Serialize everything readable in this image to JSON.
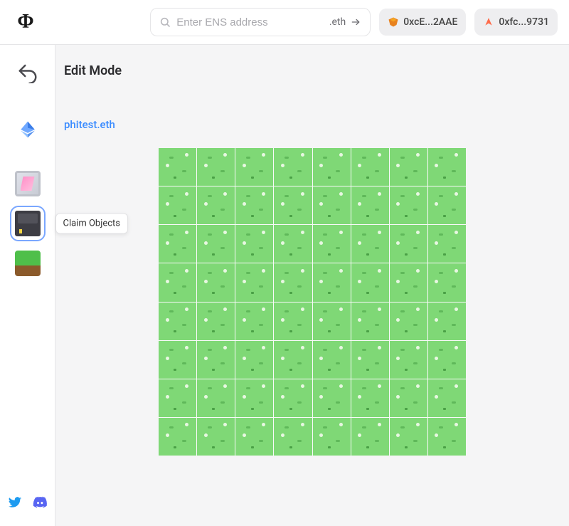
{
  "header": {
    "logo_text": "Φ",
    "search_placeholder": "Enter ENS address",
    "search_suffix": ".eth",
    "wallets": [
      {
        "label": "0xcE...2AAE",
        "icon": "metamask"
      },
      {
        "label": "0xfc...9731",
        "icon": "argent"
      }
    ]
  },
  "sidebar": {
    "items": [
      {
        "name": "undo",
        "tooltip": ""
      },
      {
        "name": "eth-diamond",
        "tooltip": ""
      },
      {
        "name": "pink-card",
        "tooltip": ""
      },
      {
        "name": "claim-objects",
        "tooltip": "Claim Objects",
        "selected": true
      },
      {
        "name": "grass-block",
        "tooltip": ""
      }
    ]
  },
  "main": {
    "title": "Edit Mode",
    "ens_name": "phitest.eth",
    "grid": {
      "rows": 8,
      "cols": 8
    }
  },
  "footer": {
    "socials": [
      "twitter",
      "discord"
    ]
  }
}
